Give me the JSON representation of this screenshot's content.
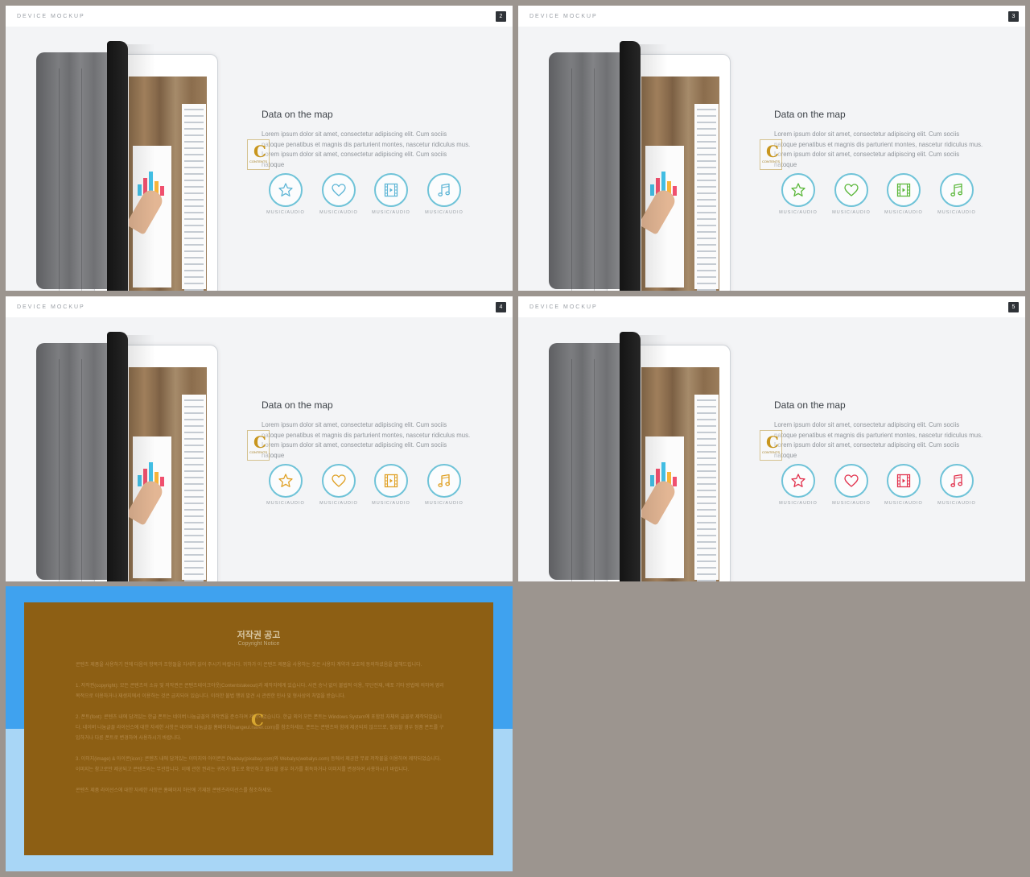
{
  "slides": [
    {
      "header": "DEVICE MOCKUP",
      "number": "2",
      "heading": "Data on the map",
      "body": "Lorem ipsum dolor sit amet, consectetur adipiscing elit. Cum sociis natoque penatibus et magnis dis parturient montes, nascetur ridiculus mus. Lorem ipsum dolor sit amet, consectetur adipiscing elit. Cum sociis natoque",
      "icon_color": "#5fb6d6",
      "icons": [
        {
          "name": "star-icon",
          "caption": "MUSIC/AUDIO"
        },
        {
          "name": "heart-icon",
          "caption": "MUSIC/AUDIO"
        },
        {
          "name": "film-icon",
          "caption": "MUSIC/AUDIO"
        },
        {
          "name": "music-note-icon",
          "caption": "MUSIC/AUDIO"
        }
      ]
    },
    {
      "header": "DEVICE MOCKUP",
      "number": "3",
      "heading": "Data on the map",
      "body": "Lorem ipsum dolor sit amet, consectetur adipiscing elit. Cum sociis natoque penatibus et magnis dis parturient montes, nascetur ridiculus mus. Lorem ipsum dolor sit amet, consectetur adipiscing elit. Cum sociis natoque",
      "icon_color": "#5cb83c",
      "icons": [
        {
          "name": "star-icon",
          "caption": "MUSIC/AUDIO"
        },
        {
          "name": "heart-icon",
          "caption": "MUSIC/AUDIO"
        },
        {
          "name": "film-icon",
          "caption": "MUSIC/AUDIO"
        },
        {
          "name": "music-note-icon",
          "caption": "MUSIC/AUDIO"
        }
      ]
    },
    {
      "header": "DEVICE MOCKUP",
      "number": "4",
      "heading": "Data on the map",
      "body": "Lorem ipsum dolor sit amet, consectetur adipiscing elit. Cum sociis natoque penatibus et magnis dis parturient montes, nascetur ridiculus mus. Lorem ipsum dolor sit amet, consectetur adipiscing elit. Cum sociis natoque",
      "icon_color": "#e0a126",
      "icons": [
        {
          "name": "star-icon",
          "caption": "MUSIC/AUDIO"
        },
        {
          "name": "heart-icon",
          "caption": "MUSIC/AUDIO"
        },
        {
          "name": "film-icon",
          "caption": "MUSIC/AUDIO"
        },
        {
          "name": "music-note-icon",
          "caption": "MUSIC/AUDIO"
        }
      ]
    },
    {
      "header": "DEVICE MOCKUP",
      "number": "5",
      "heading": "Data on the map",
      "body": "Lorem ipsum dolor sit amet, consectetur adipiscing elit. Cum sociis natoque penatibus et magnis dis parturient montes, nascetur ridiculus mus. Lorem ipsum dolor sit amet, consectetur adipiscing elit. Cum sociis natoque",
      "icon_color": "#e2334e",
      "icons": [
        {
          "name": "star-icon",
          "caption": "MUSIC/AUDIO"
        },
        {
          "name": "heart-icon",
          "caption": "MUSIC/AUDIO"
        },
        {
          "name": "film-icon",
          "caption": "MUSIC/AUDIO"
        },
        {
          "name": "music-note-icon",
          "caption": "MUSIC/AUDIO"
        }
      ]
    }
  ],
  "watermark": {
    "letter": "C",
    "text": "CONTENTS"
  },
  "colors": {
    "background": "#9c958f",
    "circle_border": "#6fc3d8",
    "notice_brown": "#8d5f14",
    "notice_blue_top": "#3fa2ef",
    "notice_blue_bottom": "#a8d6f6"
  },
  "notice": {
    "title": "저작권 공고",
    "subtitle": "Copyright Notice",
    "paragraphs": [
      "콘텐츠 제품을 사용하기 전에 다음의 항목과 조항들을 자세히 읽어 주시기 바랍니다. 귀하가 이 콘텐츠 제품을 사용하는 것은 사용자 계약과 보호에 동의하셨음을 말해드립니다.",
      "1. 저작권(copyright): 모든 콘텐츠의 소유 및 저작권은 콘텐츠테이크아웃(Contentstakeout)과 제작자에게 있습니다. 사전 승낙 없이 불법적 이용, 무단전재, 배포 기타 방법에 의하여 영리 목적으로 이용하거나 재생지에서 이용하는 것은 금지되어 있습니다. 이러한 불법 행위 발견 시 관련한 민사 및 형사상의 처벌을 받습니다.",
      "2. 폰트(font): 콘텐츠 내에 담겨있는 한글 폰트는 네이버 나눔글꼴의 저작권을 준수하여 제작되었습니다. 한글 외의 모든 폰트는 Windows System에 포함된 자체의 글꼴로 제작되었습니다. 네이버 나눔글꼴 라이선스에 대한 자세한 사항은 네이버 나눔글꼴 홈페이지(hangeul.naver.com)를 참조하세요. 폰트는 콘텐츠와 함께 제공되지 않으므로, 필요할 경우 정품 폰트를 구입하거나 다른 폰트로 변경하여 사용하시기 바랍니다.",
      "3. 이미지(image) & 아이콘(icon): 콘텐츠 내에 담겨있는 이미지와 아이콘은 Pixabay(pixabay.com)와 Webalys(webalys.com) 등에서 제공한 무료 저작물을 이용하여 제작되었습니다. 이미지는 참고로만 제공되고 콘텐츠와는 무관합니다. 이에 관한 권리는 귀하가 별도로 확인하고 필요할 경우 허가를 취득하거나 이미지를 변경하여 사용하시기 바랍니다.",
      "콘텐츠 제품 라이선스에 대한 자세한 사항은 홈페이지 하단에 기재된 콘텐츠라이선스를 참조하세요."
    ]
  }
}
